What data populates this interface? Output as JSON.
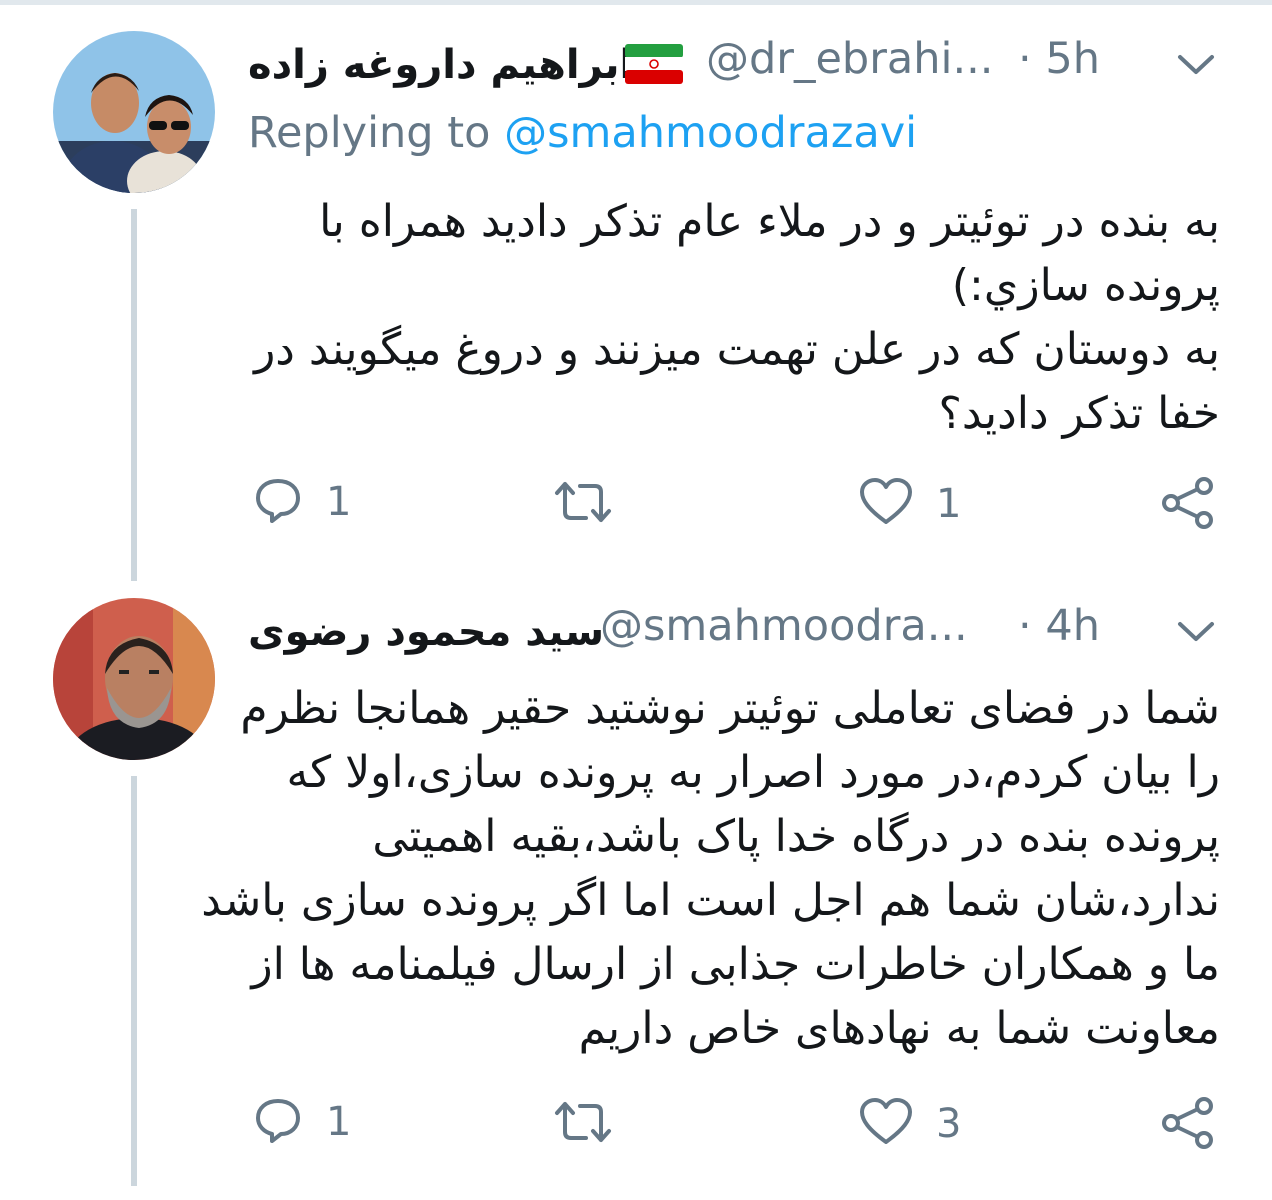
{
  "tweets": [
    {
      "display_name": "ابراهیم داروغه زاده",
      "handle": "@dr_ebrahi...",
      "time": "· 5h",
      "replying_prefix": "Replying to",
      "replying_to": "@smahmoodrazavi",
      "text_lines": [
        "به بنده در توئیتر و در ملاء عام تذکر دادید همراه با",
        "پرونده سازي:)",
        "به دوستان که در علن تهمت میزنند و دروغ میگویند در",
        "خفا تذکر دادید؟"
      ],
      "reply_count": "1",
      "like_count": "1",
      "icons": [
        "reply-icon",
        "retweet-icon",
        "like-icon",
        "share-icon",
        "chevron-down-icon",
        "iran-flag-icon"
      ]
    },
    {
      "display_name": "سید محمود رضوی",
      "handle": "@smahmoodra...",
      "time": "· 4h",
      "text_lines": [
        "شما در فضای تعاملی توئیتر نوشتید حقیر همانجا نظرم",
        "را بیان کردم،در مورد اصرار به پرونده سازی،اولا که",
        "پرونده بنده در درگاه خدا پاک باشد،بقیه اهمیتی",
        "ندارد،شان شما هم اجل است اما اگر پرونده سازی باشد",
        "ما و همکاران خاطرات جذابی از ارسال فیلمنامه ها از",
        "معاونت شما به نهادهای خاص داریم"
      ],
      "reply_count": "1",
      "like_count": "3",
      "icons": [
        "reply-icon",
        "retweet-icon",
        "like-icon",
        "share-icon",
        "chevron-down-icon"
      ]
    }
  ],
  "colors": {
    "text": "#14171a",
    "secondary": "#657786",
    "link": "#1da1f2",
    "thread_line": "#ccd6dd"
  }
}
